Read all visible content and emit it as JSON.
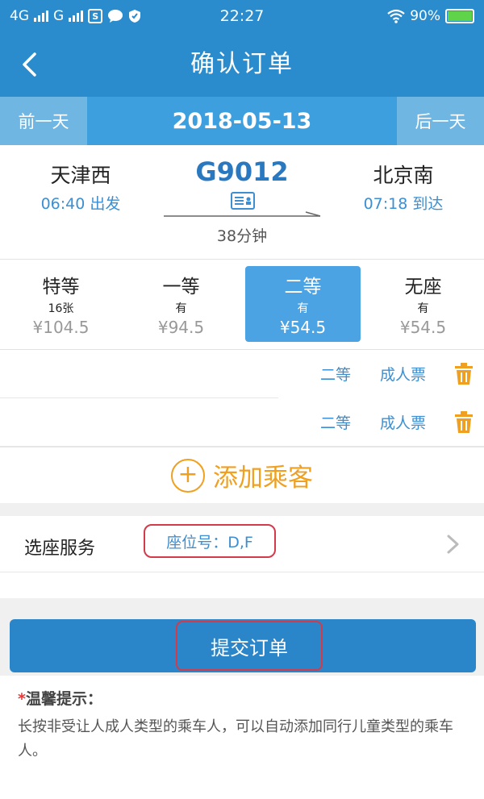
{
  "status": {
    "net1": "4G",
    "net2": "G",
    "time": "22:27",
    "battery": "90%"
  },
  "nav": {
    "title": "确认订单"
  },
  "date_bar": {
    "prev_label": "前一天",
    "date": "2018-05-13",
    "next_label": "后一天"
  },
  "train": {
    "from_station": "天津西",
    "from_time": "06:40 出发",
    "number": "G9012",
    "duration": "38分钟",
    "to_station": "北京南",
    "to_time": "07:18 到达"
  },
  "seat_classes": [
    {
      "name": "特等",
      "avail": "16张",
      "price": "¥104.5"
    },
    {
      "name": "一等",
      "avail": "有",
      "price": "¥94.5"
    },
    {
      "name": "二等",
      "avail": "有",
      "price": "¥54.5"
    },
    {
      "name": "无座",
      "avail": "有",
      "price": "¥54.5"
    }
  ],
  "passengers": [
    {
      "seat_class": "二等",
      "ticket_type": "成人票"
    },
    {
      "seat_class": "二等",
      "ticket_type": "成人票"
    }
  ],
  "add_passenger_label": "添加乘客",
  "seat_service": {
    "label": "选座服务",
    "value": "座位号：D,F"
  },
  "submit_label": "提交订单",
  "tips": {
    "star": "*",
    "title": "温馨提示：",
    "text": "长按非受让人成人类型的乘车人，可以自动添加同行儿童类型的乘车人。"
  },
  "colors": {
    "primary": "#2a8ccd",
    "accent_orange": "#f0a020",
    "highlight_red": "#d33a4a",
    "active_seat": "#4ba3e3"
  }
}
